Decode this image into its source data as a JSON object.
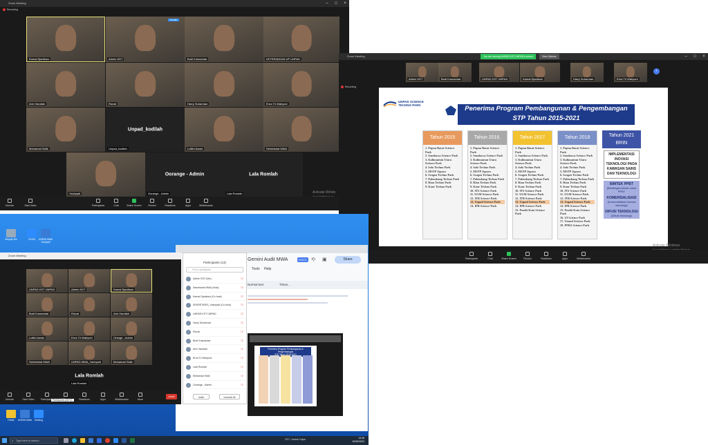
{
  "win1": {
    "title": "Zoom Meeting",
    "recording": "Recording",
    "top_badge": "Gender",
    "tiles": [
      {
        "name": "Kamal Djanikwa"
      },
      {
        "name": "Admin KDT"
      },
      {
        "name": "Budi Kusnandar"
      },
      {
        "name": "KETERANGAN UP UNPAD"
      },
      {
        "name": "Arin Handiah"
      },
      {
        "name": "Rizzal"
      },
      {
        "name": "Harry Suharman"
      },
      {
        "name": "Erna Tri Wahyuni"
      },
      {
        "name": "Mohamad Sidik"
      },
      {
        "name": "Unpad_kodilah",
        "big": "Unpad_kodilah"
      },
      {
        "name": "Lutfini Aswin"
      },
      {
        "name": "Sekretariat MWA"
      },
      {
        "name": "Yachyadi"
      },
      {
        "name": "Oorange - Admin",
        "big": "Oorange - Admin"
      },
      {
        "name": "Lala Romlah",
        "big": "Lala Romlah"
      }
    ],
    "activate": [
      "Activate Windo",
      "Go to Settings to ac"
    ],
    "controls": [
      "Unmute",
      "Start Video",
      "Participants",
      "Chat",
      "Share Screen",
      "Record",
      "Reactions",
      "Apps",
      "Whiteboards"
    ]
  },
  "win2": {
    "title": "Zoom Meeting",
    "banner": "You are viewing UNPAD KST UNPAD's screen",
    "view_options": "View Options",
    "recording": "Recording",
    "strip": [
      "Admin KDT",
      "Budi Kusnandar",
      "UNPAD KST UNPAD",
      "Kamal Djanikwa",
      "Harry Suharman",
      "Erna Tri Wahyuni"
    ],
    "activate": [
      "Activate Windows",
      "Go to Settings to activate Windows."
    ],
    "controls": [
      "Participants",
      "Chat",
      "Share Screen",
      "Record",
      "Reactions",
      "Apps",
      "Whiteboards"
    ],
    "slide": {
      "logo_text": "UNPAD SCIENCE TECHNO PARK",
      "title": "Penerima Program Pembangunan & Pengembangan",
      "subtitle": "STP Tahun 2015-2021",
      "columns": [
        {
          "year": "Tahun 2015",
          "color": "#e89a5e",
          "items": [
            "1. Papua Barat Science Park",
            "2. Sumbawa Science Park",
            "3. Kalimantan Utara Science Park",
            "4. Solo Techno Park",
            "5. MSTP Jepara",
            "6. Sragen Techno Park",
            "7. Palembang Techno Park",
            "8. Riau Techno Park",
            "9. Kaur Techno Park"
          ]
        },
        {
          "year": "Tahun 2016.",
          "color": "#a9a9a9",
          "items": [
            "1. Papua Barat Science Park",
            "2. Sumbawa Science Park",
            "3. Kalimantan Utara Science Park",
            "4. Solo Techno Park",
            "5. MSTP Jepara",
            "6. Sragen Techno Park",
            "7. Palembang Techno Park",
            "8. Riau Techno Park",
            "9. Kaur Techno Park",
            "10. ITS Science Park",
            "11. UGM Science Park",
            "12. ITB Science Park",
            "13. Unpad Science Park",
            "14. IPB Science Park"
          ]
        },
        {
          "year": "Tahun 2017",
          "color": "#f2c230",
          "items": [
            "1. Papua Barat Science Park",
            "2. Sumbawa Science Park",
            "3. Kalimantan Utara Science Park",
            "4. Solo Techno Park",
            "5. MSTP Jepara",
            "6. Sragen Techno Park",
            "7. Palembang Techno Park",
            "8. Riau Techno Park",
            "9. Kaur Techno Park",
            "10. ITS Science Park",
            "11. UGM Science Park",
            "12. ITB Science Park",
            "13. Unpad Science Park",
            "14. IPB Science Park",
            "15. Pusdit Kota Science Park"
          ]
        },
        {
          "year": "Tahun 2018",
          "color": "#7b8fc8",
          "items": [
            "1. Papua Barat Science Park",
            "2. Sumbawa Science Park",
            "3. Kalimantan Utara Science Park",
            "4. Solo Techno Park",
            "5. MSTP Jepara",
            "6. Sragen Techno Park",
            "7. Palembang Techno Park",
            "8. Riau Techno Park",
            "9. Kaur Techno Park",
            "10. ITS Science Park",
            "11. UGM Science Park",
            "12. ITB Science Park",
            "13. Unpad Science Park",
            "14. IPB Science Park",
            "15. Pusdit Kota Science Park",
            "16. UI Science Park",
            "17. Unand Science Park",
            "18. PPKS Science Park"
          ]
        }
      ],
      "brin": {
        "year": "Tahun 2021",
        "org": "BRIN",
        "box1": "IMPLEMENTASI INOVASI TEKNOLOGI PADA KAWASAN SAINS DAN TEKNOLOGI",
        "bimtek": "BIMTEK PPBT",
        "bimtek_sub": "(Bimbingan teknis untuk PPBT",
        "komers": "KOMERSIALISASI",
        "komers_sub": "(Komersialisasi inovasi teknologi)",
        "difusi": "DIFUSI TEKNOLOGI",
        "difusi_sub": "(Difusi teknologi)"
      }
    }
  },
  "win3": {
    "title": "Zoom Meeting",
    "tiles": [
      {
        "name": "UNPAD KST UNPAD"
      },
      {
        "name": "Admin KDT"
      },
      {
        "name": "Kamal Djanikwa"
      },
      {
        "name": "Budi Kusnandar"
      },
      {
        "name": "Rizzal"
      },
      {
        "name": "Arin Handiah"
      },
      {
        "name": "Lutfini Aswin"
      },
      {
        "name": "Erna Tri Wahyuni"
      },
      {
        "name": "Orange - Admin"
      },
      {
        "name": "Sekretariat MWA"
      },
      {
        "name": "UNPAD MWA_Yachyadi"
      },
      {
        "name": "Mohamad Sidik"
      },
      {
        "name": "Lala Romlah",
        "big": "Lala Romlah"
      }
    ],
    "controls": [
      "Unmute",
      "Start Video",
      "Participants",
      "Share",
      "Reactions",
      "Apps",
      "Whiteboards",
      "More"
    ],
    "end": "Leave",
    "tooltip": "Participants (Alt+U)"
  },
  "participants": {
    "title": "Participants (13)",
    "search": "Find a participant",
    "rows": [
      "Admin KDT (Me)",
      "Sekretariat MWA (Host)",
      "Kamal Djanikwa (Co-host)",
      "SEKRETARIS_Yachyadi (Co-host)",
      "UNPAD KST UNPAD",
      "Harry Suharman",
      "Rizzal",
      "Budi Kusnandar",
      "Arin Handiah",
      "Erna Tri Wahyuni",
      "Lala Romlah",
      "Mohamad Sidik",
      "Oorange - Admin"
    ],
    "invite": "Invite",
    "mute_all": "Unmute All"
  },
  "doc": {
    "tab_title": "Gemini Audit MWA",
    "badge": "DOCX",
    "share": "Share",
    "menus": [
      "Tools",
      "Help"
    ],
    "style": "Normal text",
    "font": "Times...",
    "embedded_title": "Penerima Program Pembangunan & Pengembangan",
    "embedded_sub": "STP Tahun 2015-2021"
  },
  "desktop": {
    "icons": [
      "Recycle Bin",
      "ZOOM",
      "UNPAD MWA Yachyadi",
      "Folder",
      "UNPAD MWA",
      "Meeting"
    ],
    "search": "Type here to search",
    "tray": [
      "29°C",
      "Jumlah Hujan"
    ],
    "time": "13:26",
    "date": "02/06/2022"
  }
}
